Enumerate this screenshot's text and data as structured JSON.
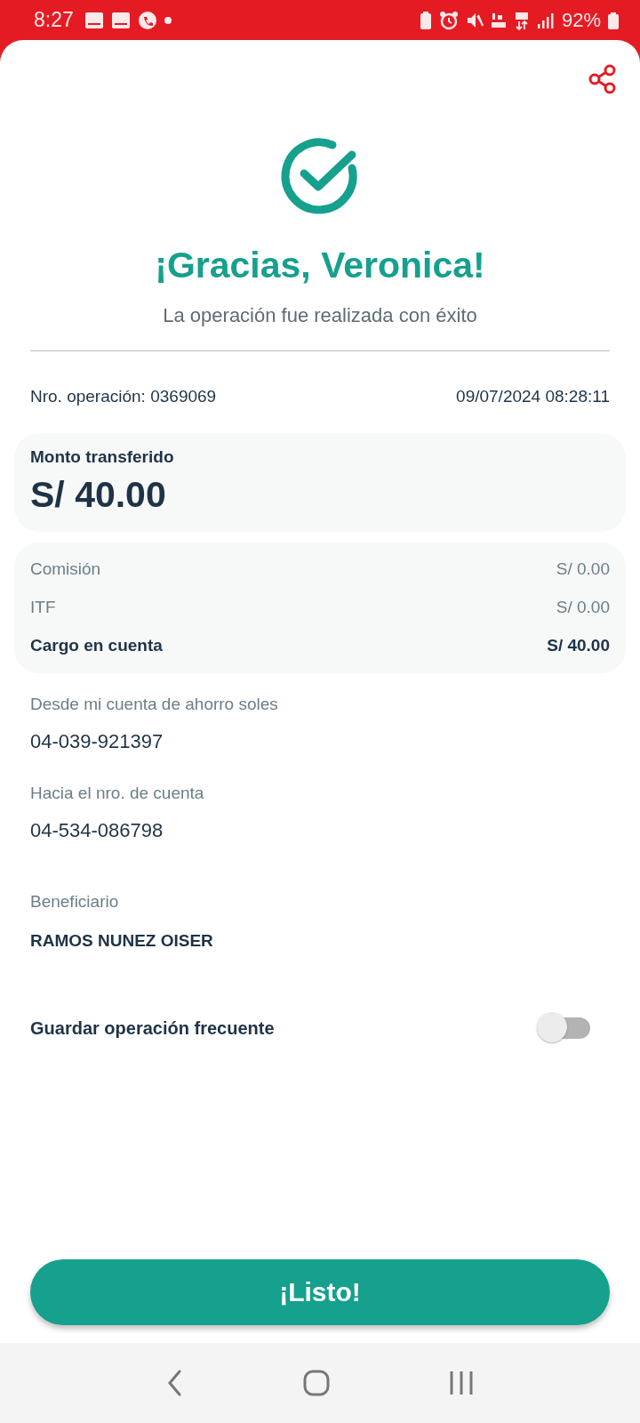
{
  "status_bar": {
    "time": "8:27",
    "battery": "92%"
  },
  "header": {
    "title": "¡Gracias, Veronica!",
    "subtitle": "La operación fue realizada con éxito"
  },
  "operation": {
    "number": "Nro. operación: 0369069",
    "datetime": "09/07/2024 08:28:11"
  },
  "amount": {
    "label": "Monto transferido",
    "value": "S/ 40.00"
  },
  "charges": [
    {
      "label": "Comisión",
      "value": "S/ 0.00",
      "kind": "fee"
    },
    {
      "label": "ITF",
      "value": "S/ 0.00",
      "kind": "fee"
    },
    {
      "label": "Cargo en cuenta",
      "value": "S/ 40.00",
      "kind": "total"
    }
  ],
  "details": [
    {
      "label": "Desde mi cuenta de ahorro soles",
      "value": "04-039-921397",
      "kind": "account"
    },
    {
      "label": "Hacia el nro. de cuenta",
      "value": "04-534-086798",
      "kind": "account"
    },
    {
      "label": "Beneficiario",
      "value": "RAMOS NUNEZ OISER",
      "kind": "name"
    }
  ],
  "frequent": {
    "label": "Guardar operación frecuente",
    "on": false
  },
  "done_button": "¡Listo!"
}
